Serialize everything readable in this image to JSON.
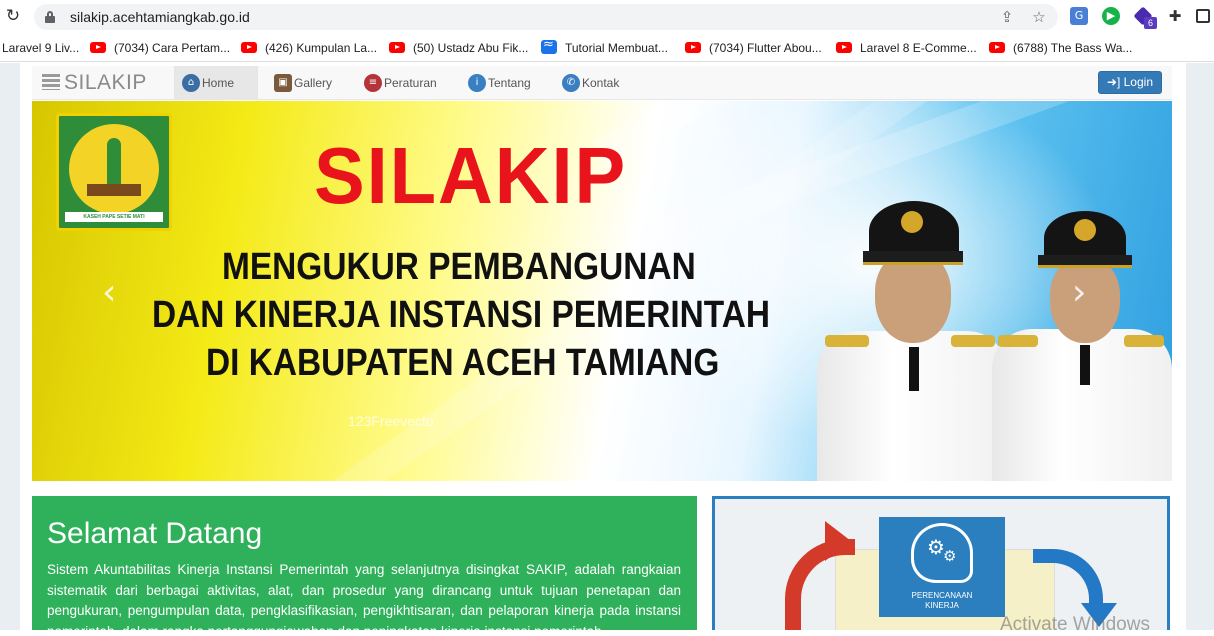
{
  "browser": {
    "url": "silakip.acehtamiangkab.go.id",
    "ext_badge": "6",
    "bookmarks": [
      {
        "label": "Laravel 9 Liv...",
        "icon": "none"
      },
      {
        "label": "(7034) Cara Pertam...",
        "icon": "youtube-icon"
      },
      {
        "label": "(426) Kumpulan La...",
        "icon": "youtube-icon"
      },
      {
        "label": "(50) Ustadz Abu Fik...",
        "icon": "youtube-icon"
      },
      {
        "label": "Tutorial Membuat...",
        "icon": "wave-icon"
      },
      {
        "label": "(7034) Flutter Abou...",
        "icon": "youtube-icon"
      },
      {
        "label": "Laravel 8 E-Comme...",
        "icon": "youtube-icon"
      },
      {
        "label": "(6788) The Bass Wa...",
        "icon": "youtube-icon"
      }
    ]
  },
  "navbar": {
    "brand": "SILAKIP",
    "items": [
      {
        "label": "Home",
        "icon": "home-icon",
        "color": "#3a6ea5",
        "active": true
      },
      {
        "label": "Gallery",
        "icon": "image-icon",
        "color": "#7a5a3a",
        "active": false
      },
      {
        "label": "Peraturan",
        "icon": "list-icon",
        "color": "#b5333a",
        "active": false
      },
      {
        "label": "Tentang",
        "icon": "info-icon",
        "color": "#3a7fc1",
        "active": false
      },
      {
        "label": "Kontak",
        "icon": "phone-icon",
        "color": "#3a7fc1",
        "active": false
      }
    ],
    "login_label": "Login"
  },
  "hero": {
    "title": "SILAKIP",
    "lines": [
      "MENGUKUR PEMBANGUNAN",
      "DAN KINERJA INSTANSI PEMERINTAH",
      "DI KABUPATEN ACEH TAMIANG"
    ],
    "emblem_text": "KASEH PAPE SETIE MATI",
    "watermark": "123Freevecto"
  },
  "welcome": {
    "heading": "Selamat Datang",
    "body": "Sistem Akuntabilitas Kinerja Instansi Pemerintah yang selanjutnya disingkat SAKIP, adalah rangkaian sistematik dari berbagai aktivitas, alat, dan prosedur yang dirancang untuk tujuan penetapan dan pengukuran, pengumpulan data, pengklasifikasian, pengikhtisaran, dan pelaporan kinerja pada instansi pemerintah, dalam rangka pertanggungjawaban dan peningkatan kinerja instansi pemerintah."
  },
  "panel": {
    "feature_label_1": "PERENCANAAN",
    "feature_label_2": "KINERJA"
  },
  "os": {
    "activate_text": "Activate Windows"
  },
  "colors": {
    "brand_blue": "#337ab7",
    "welcome_green": "#2eb15a",
    "hero_red": "#e8131b"
  }
}
